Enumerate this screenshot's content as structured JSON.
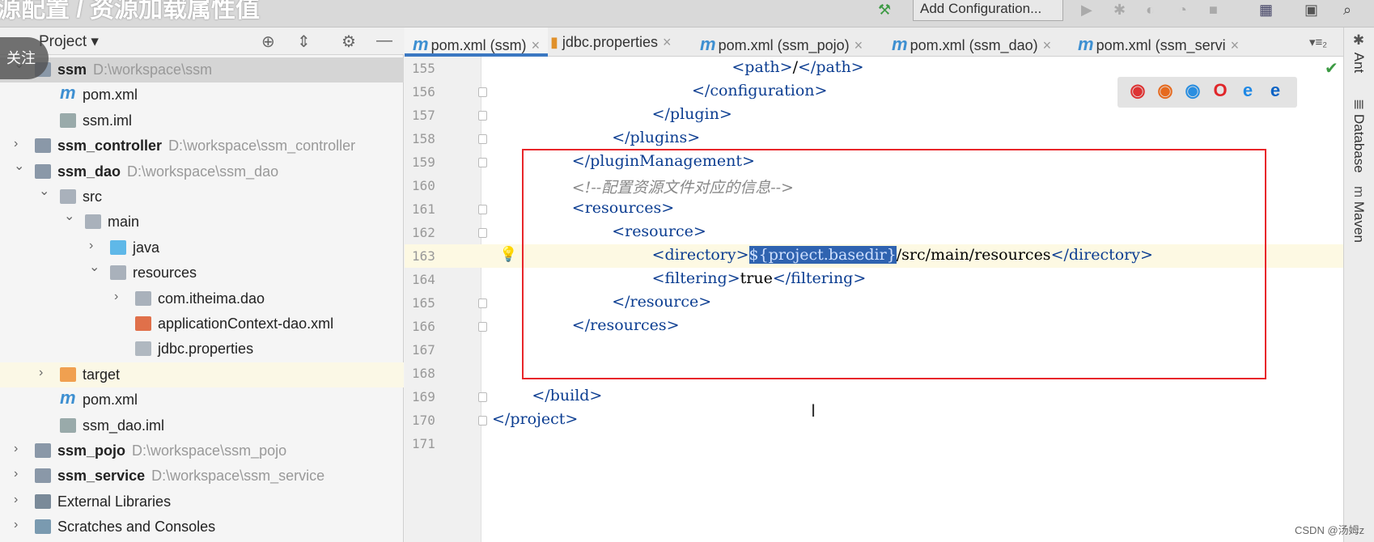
{
  "overlay": {
    "title": "源配置 / 资源加载属性值",
    "follow": "关注",
    "watermark": "CSDN @汤姆z"
  },
  "toolbar": {
    "add_configuration": "Add Configuration..."
  },
  "project_panel": {
    "label": "Project",
    "rows": [
      {
        "depth": 0,
        "chev": "v",
        "icon": "module",
        "name": "ssm",
        "path": "D:\\workspace\\ssm",
        "bold": true,
        "selected": true
      },
      {
        "depth": 1,
        "chev": "",
        "icon": "maven",
        "name": "pom.xml"
      },
      {
        "depth": 1,
        "chev": "",
        "icon": "iml",
        "name": "ssm.iml"
      },
      {
        "depth": 0,
        "chev": ">",
        "icon": "module",
        "name": "ssm_controller",
        "path": "D:\\workspace\\ssm_controller",
        "bold": true
      },
      {
        "depth": 0,
        "chev": "v",
        "icon": "module",
        "name": "ssm_dao",
        "path": "D:\\workspace\\ssm_dao",
        "bold": true
      },
      {
        "depth": 1,
        "chev": "v",
        "icon": "folder",
        "name": "src"
      },
      {
        "depth": 2,
        "chev": "v",
        "icon": "folder",
        "name": "main"
      },
      {
        "depth": 3,
        "chev": ">",
        "icon": "folder-blue",
        "name": "java"
      },
      {
        "depth": 3,
        "chev": "v",
        "icon": "folder-res",
        "name": "resources"
      },
      {
        "depth": 4,
        "chev": ">",
        "icon": "folder",
        "name": "com.itheima.dao"
      },
      {
        "depth": 4,
        "chev": "",
        "icon": "xml",
        "name": "applicationContext-dao.xml"
      },
      {
        "depth": 4,
        "chev": "",
        "icon": "properties",
        "name": "jdbc.properties"
      },
      {
        "depth": 1,
        "chev": ">",
        "icon": "folder-orange",
        "name": "target",
        "highlight": true
      },
      {
        "depth": 1,
        "chev": "",
        "icon": "maven",
        "name": "pom.xml"
      },
      {
        "depth": 1,
        "chev": "",
        "icon": "iml",
        "name": "ssm_dao.iml"
      },
      {
        "depth": 0,
        "chev": ">",
        "icon": "module",
        "name": "ssm_pojo",
        "path": "D:\\workspace\\ssm_pojo",
        "bold": true
      },
      {
        "depth": 0,
        "chev": ">",
        "icon": "module",
        "name": "ssm_service",
        "path": "D:\\workspace\\ssm_service",
        "bold": true
      },
      {
        "depth": 0,
        "chev": ">",
        "icon": "libraries",
        "name": "External Libraries"
      },
      {
        "depth": 0,
        "chev": ">",
        "icon": "scratches",
        "name": "Scratches and Consoles"
      }
    ]
  },
  "tabs": [
    {
      "label": "pom.xml (ssm)",
      "icon": "maven",
      "active": true
    },
    {
      "label": "jdbc.properties",
      "icon": "properties"
    },
    {
      "label": "pom.xml (ssm_pojo)",
      "icon": "maven"
    },
    {
      "label": "pom.xml (ssm_dao)",
      "icon": "maven"
    },
    {
      "label": "pom.xml (ssm_servi",
      "icon": "maven"
    }
  ],
  "tabs_overflow": "▾≡₂",
  "editor": {
    "current_line": 163,
    "lines": [
      {
        "n": "155",
        "fold": false,
        "ind": 6,
        "tok": [
          [
            "t",
            "<path>"
          ],
          [
            "tn",
            "/"
          ],
          [
            "t",
            "</path>"
          ]
        ]
      },
      {
        "n": "156",
        "fold": true,
        "ind": 5,
        "tok": [
          [
            "t",
            "</configuration>"
          ]
        ]
      },
      {
        "n": "157",
        "fold": true,
        "ind": 4,
        "tok": [
          [
            "t",
            "</plugin>"
          ]
        ]
      },
      {
        "n": "158",
        "fold": true,
        "ind": 3,
        "tok": [
          [
            "t",
            "</plugins>"
          ]
        ]
      },
      {
        "n": "159",
        "fold": true,
        "ind": 2,
        "tok": [
          [
            "t",
            "</pluginManagement>"
          ]
        ]
      },
      {
        "n": "160",
        "fold": false,
        "ind": 2,
        "tok": [
          [
            "cm",
            "<!--配置资源文件对应的信息-->"
          ]
        ]
      },
      {
        "n": "161",
        "fold": true,
        "ind": 2,
        "tok": [
          [
            "t",
            "<resources>"
          ]
        ]
      },
      {
        "n": "162",
        "fold": true,
        "ind": 3,
        "tok": [
          [
            "t",
            "<resource>"
          ]
        ]
      },
      {
        "n": "163",
        "fold": false,
        "ind": 4,
        "bulb": true,
        "tok": [
          [
            "t",
            "<directory>"
          ],
          [
            "selx",
            "${project.basedir}"
          ],
          [
            "tn",
            "/src/main/resources"
          ],
          [
            "t",
            "</directory>"
          ]
        ]
      },
      {
        "n": "164",
        "fold": false,
        "ind": 4,
        "tok": [
          [
            "t",
            "<filtering>"
          ],
          [
            "tn",
            "true"
          ],
          [
            "t",
            "</filtering>"
          ]
        ]
      },
      {
        "n": "165",
        "fold": true,
        "ind": 3,
        "tok": [
          [
            "t",
            "</resource>"
          ]
        ]
      },
      {
        "n": "166",
        "fold": true,
        "ind": 2,
        "tok": [
          [
            "t",
            "</resources>"
          ]
        ]
      },
      {
        "n": "167",
        "fold": false,
        "ind": 0,
        "tok": []
      },
      {
        "n": "168",
        "fold": false,
        "ind": 0,
        "tok": []
      },
      {
        "n": "169",
        "fold": true,
        "ind": 1,
        "tok": [
          [
            "t",
            "</build>"
          ]
        ]
      },
      {
        "n": "170",
        "fold": true,
        "ind": 0,
        "tok": [
          [
            "t",
            "</project>"
          ]
        ]
      },
      {
        "n": "171",
        "fold": false,
        "ind": 0,
        "tok": []
      }
    ]
  },
  "browsers": [
    "chrome",
    "firefox",
    "safari",
    "opera",
    "internet-explorer",
    "edge"
  ],
  "right_tools": [
    "Ant",
    "Database",
    "Maven"
  ],
  "colors": {
    "accent": "#3b78c2",
    "highlight_box": "#e8262a",
    "selection": "#2f63b0",
    "tag": "#0b3d91"
  }
}
